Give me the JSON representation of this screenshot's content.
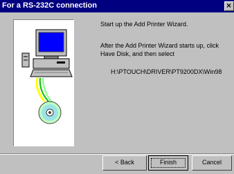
{
  "window": {
    "title": "For a RS-232C connection"
  },
  "content": {
    "line1": "Start up the Add Printer Wizard.",
    "line2": "After the Add Printer Wizard starts up, click Have Disk, and then select",
    "path": "H:\\PTOUCH\\DRIVER\\PT9200DX\\Win98"
  },
  "buttons": {
    "back": "< Back",
    "finish": "Finish",
    "cancel": "Cancel"
  },
  "icons": [
    "computer-icon",
    "cd-disk-icon",
    "close-icon"
  ]
}
